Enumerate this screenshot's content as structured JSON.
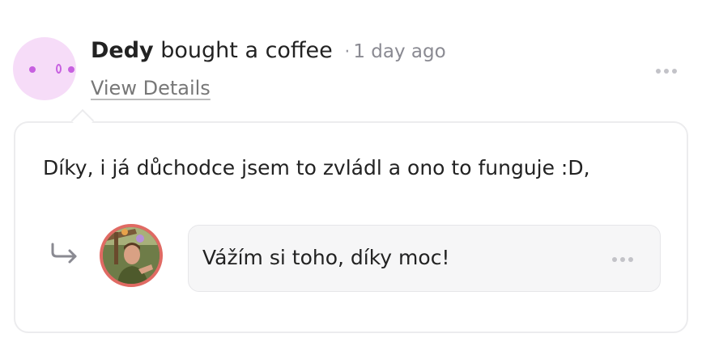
{
  "feed_item": {
    "supporter_name": "Dedy",
    "action": "bought a coffee",
    "separator": "·",
    "time_ago": "1 day ago",
    "view_details_label": "View Details"
  },
  "message": {
    "text": "Díky, i já důchodce jsem to zvládl a ono to funguje :D,"
  },
  "reply": {
    "text": "Vážím si toho, díky moc!"
  },
  "colors": {
    "supporter_avatar_bg": "#f6dcf8",
    "supporter_avatar_face": "#c760e0",
    "creator_avatar_ring": "#e06a63",
    "reply_bubble_bg": "#f6f6f7"
  },
  "icons": {
    "more_options": "more-horizontal-icon",
    "reply": "reply-arrow-icon"
  }
}
